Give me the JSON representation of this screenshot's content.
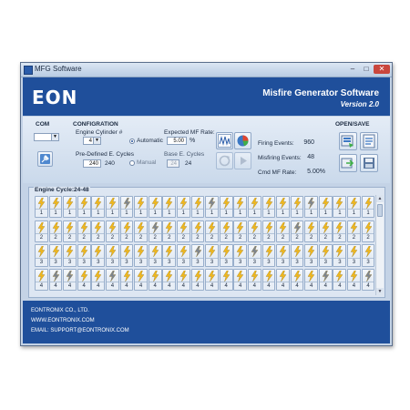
{
  "window": {
    "title": "MFG Software",
    "buttons": {
      "minimize": "–",
      "maximize": "□",
      "close": "✕"
    }
  },
  "header": {
    "logo": "EON",
    "title": "Misfire Generator Software",
    "version": "Version 2.0"
  },
  "com": {
    "label": "COM",
    "selected": ""
  },
  "config": {
    "label": "CONFIGRATION",
    "engine_cylinder_label": "Engine Cylinder #",
    "engine_cylinder_value": "4",
    "predefined_label": "Pre-Defined E. Cycles",
    "predefined_value": "240",
    "predefined_readout": "240",
    "mode_automatic": "Automatic",
    "mode_manual": "Manual",
    "expected_mf_label": "Expected MF Rate:",
    "expected_mf_value": "5.00",
    "expected_mf_unit": "%",
    "base_cycles_label": "Base E. Cycles",
    "base_cycles_value": "24",
    "base_cycles_readout": "24"
  },
  "stats": {
    "firing_label": "Firing Events:",
    "firing_value": "960",
    "misfiring_label": "Misfiring Events:",
    "misfiring_value": "48",
    "cmd_label": "Cmd MF Rate:",
    "cmd_value": "5.00%"
  },
  "openSave": {
    "label": "OPEN/SAVE"
  },
  "cycles": {
    "title": "Engine Cycle:24-48",
    "misfires": [
      [
        2,
        3
      ],
      [
        5,
        3
      ],
      [
        8,
        1
      ],
      [
        12,
        0
      ],
      [
        15,
        2
      ],
      [
        18,
        1
      ],
      [
        20,
        3
      ],
      [
        23,
        3
      ],
      [
        1,
        3
      ],
      [
        6,
        0
      ],
      [
        11,
        2
      ],
      [
        19,
        0
      ]
    ]
  },
  "footer": {
    "company": "EONTRONIX CO., LTD.",
    "web": "WWW.EONTRONIX.COM",
    "email": "EMAIL: SUPPORT@EONTRONIX.COM"
  },
  "colors": {
    "header_bg": "#1f4f9b",
    "firing": "#f0b81e",
    "misfire": "#7d8590"
  }
}
